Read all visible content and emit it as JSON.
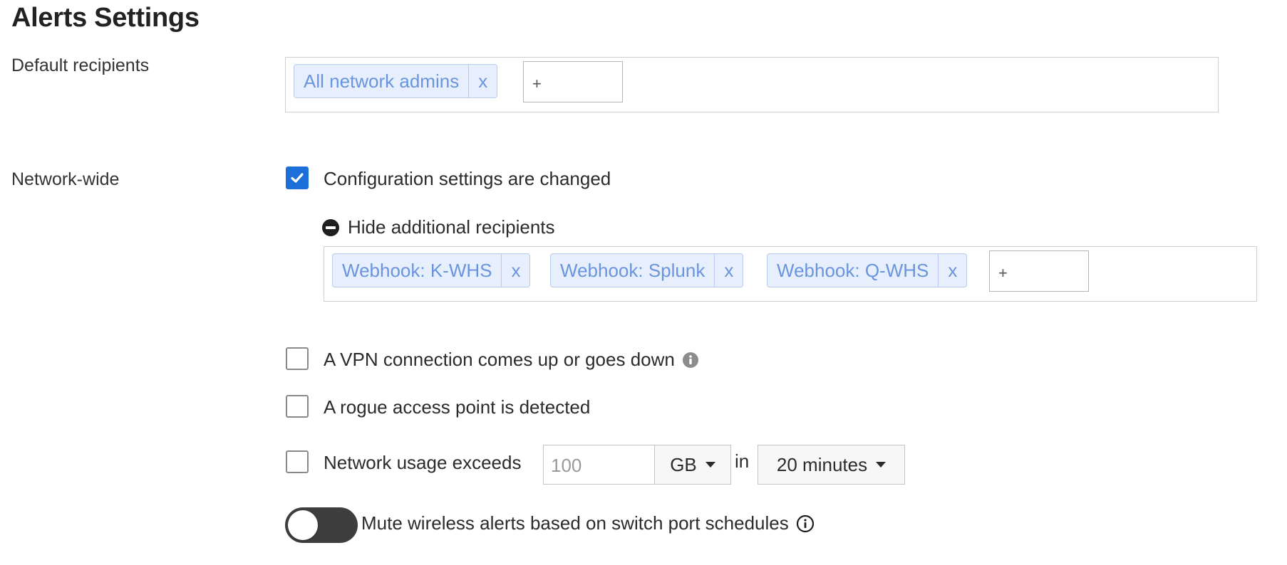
{
  "page": {
    "title": "Alerts Settings"
  },
  "default_recipients": {
    "label": "Default recipients",
    "chips": [
      {
        "label": "All network admins",
        "remove": "x"
      }
    ],
    "add_placeholder": "+"
  },
  "network_wide": {
    "label": "Network-wide",
    "config_changed": {
      "label": "Configuration settings are changed",
      "checked": true
    },
    "hide_recipients_label": "Hide additional recipients",
    "additional_recipients": {
      "chips": [
        {
          "label": "Webhook: K-WHS",
          "remove": "x"
        },
        {
          "label": "Webhook: Splunk",
          "remove": "x"
        },
        {
          "label": "Webhook: Q-WHS",
          "remove": "x"
        }
      ],
      "add_placeholder": "+"
    },
    "vpn": {
      "label": "A VPN connection comes up or goes down",
      "checked": false
    },
    "rogue_ap": {
      "label": "A rogue access point is detected",
      "checked": false
    },
    "usage": {
      "label": "Network usage exceeds",
      "checked": false,
      "amount_placeholder": "100",
      "unit": "GB",
      "in_label": "in",
      "period": "20 minutes"
    },
    "mute_wireless": {
      "label": "Mute wireless alerts based on switch port schedules",
      "enabled": false
    }
  },
  "colors": {
    "accent": "#1c6fd9",
    "chip_bg": "#e7effc",
    "chip_text": "#6a95de",
    "toggle_off": "#3e3e3e"
  }
}
